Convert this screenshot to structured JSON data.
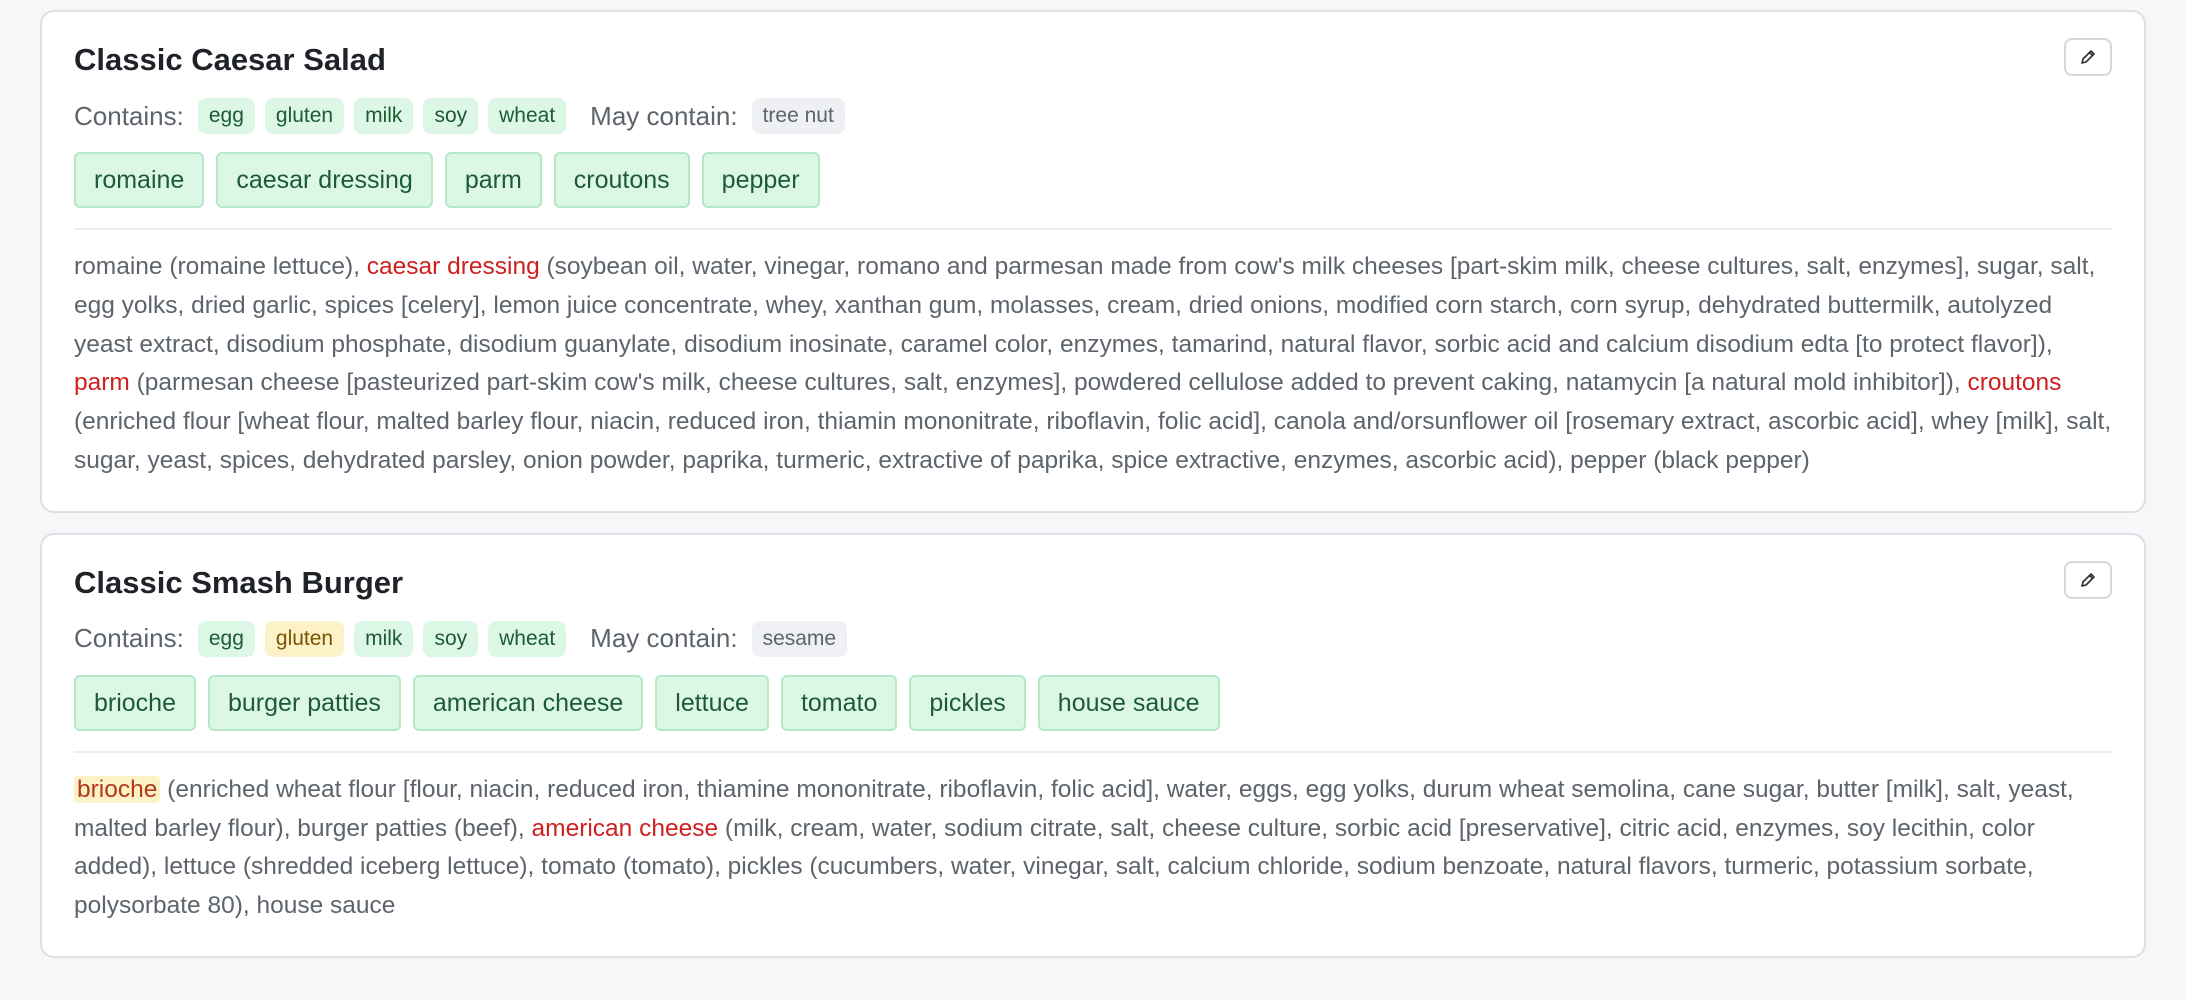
{
  "labels": {
    "contains": "Contains:",
    "may_contain": "May contain:"
  },
  "colors": {
    "green_chip_bg": "#dcf7e5",
    "green_text": "#1d5b34",
    "yellow_chip_bg": "#fdf1c7",
    "red_highlight": "#cf2020"
  },
  "recipes": [
    {
      "title": "Classic Caesar Salad",
      "edit_icon": "pencil-icon",
      "contains": [
        {
          "label": "egg",
          "tone": "green"
        },
        {
          "label": "gluten",
          "tone": "green"
        },
        {
          "label": "milk",
          "tone": "green"
        },
        {
          "label": "soy",
          "tone": "green"
        },
        {
          "label": "wheat",
          "tone": "green"
        }
      ],
      "may_contain": [
        "tree nut"
      ],
      "ingredients": [
        "romaine",
        "caesar dressing",
        "parm",
        "croutons",
        "pepper"
      ],
      "text_segments": [
        {
          "t": "romaine (romaine lettuce), ",
          "s": ""
        },
        {
          "t": "caesar dressing",
          "s": "red"
        },
        {
          "t": " (soybean oil, water, vinegar, romano and parmesan made from cow's milk cheeses [part-skim milk, cheese cultures, salt, enzymes], sugar, salt, egg yolks, dried garlic, spices [celery], lemon juice concentrate, whey, xanthan gum, molasses, cream, dried onions, modified corn starch, corn syrup, dehydrated buttermilk, autolyzed yeast extract, disodium phosphate, disodium guanylate, disodium inosinate, caramel color, enzymes, tamarind, natural flavor, sorbic acid and calcium disodium edta [to protect flavor]), ",
          "s": ""
        },
        {
          "t": "parm",
          "s": "red"
        },
        {
          "t": " (parmesan cheese [pasteurized part-skim cow's milk, cheese cultures, salt, enzymes], powdered cellulose added to prevent caking, natamycin [a natural mold inhibitor]), ",
          "s": ""
        },
        {
          "t": "croutons",
          "s": "red"
        },
        {
          "t": " (enriched flour [wheat flour, malted barley flour, niacin, reduced iron, thiamin mononitrate, riboflavin, folic acid], canola and/orsunflower oil [rosemary extract, ascorbic acid], whey [milk], salt, sugar, yeast, spices, dehydrated parsley, onion powder, paprika, turmeric, extractive of paprika, spice extractive, enzymes, ascorbic acid), pepper (black pepper)",
          "s": ""
        }
      ]
    },
    {
      "title": "Classic Smash Burger",
      "edit_icon": "pencil-icon",
      "contains": [
        {
          "label": "egg",
          "tone": "green"
        },
        {
          "label": "gluten",
          "tone": "yellow"
        },
        {
          "label": "milk",
          "tone": "green"
        },
        {
          "label": "soy",
          "tone": "green"
        },
        {
          "label": "wheat",
          "tone": "green"
        }
      ],
      "may_contain": [
        "sesame"
      ],
      "ingredients": [
        "brioche",
        "burger patties",
        "american cheese",
        "lettuce",
        "tomato",
        "pickles",
        "house sauce"
      ],
      "text_segments": [
        {
          "t": "brioche",
          "s": "yellow"
        },
        {
          "t": " (enriched wheat flour [flour, niacin, reduced iron, thiamine mononitrate, riboflavin, folic acid], water, eggs, egg yolks, durum wheat semolina, cane sugar, butter [milk], salt, yeast, malted barley flour), burger patties (beef), ",
          "s": ""
        },
        {
          "t": "american cheese",
          "s": "red"
        },
        {
          "t": " (milk, cream, water, sodium citrate, salt, cheese culture, sorbic acid [preservative], citric acid, enzymes, soy lecithin, color added), lettuce (shredded iceberg lettuce), tomato (tomato), pickles (cucumbers, water, vinegar, salt, calcium chloride, sodium benzoate, natural flavors, turmeric, potassium sorbate, polysorbate 80), house sauce",
          "s": ""
        }
      ]
    }
  ]
}
